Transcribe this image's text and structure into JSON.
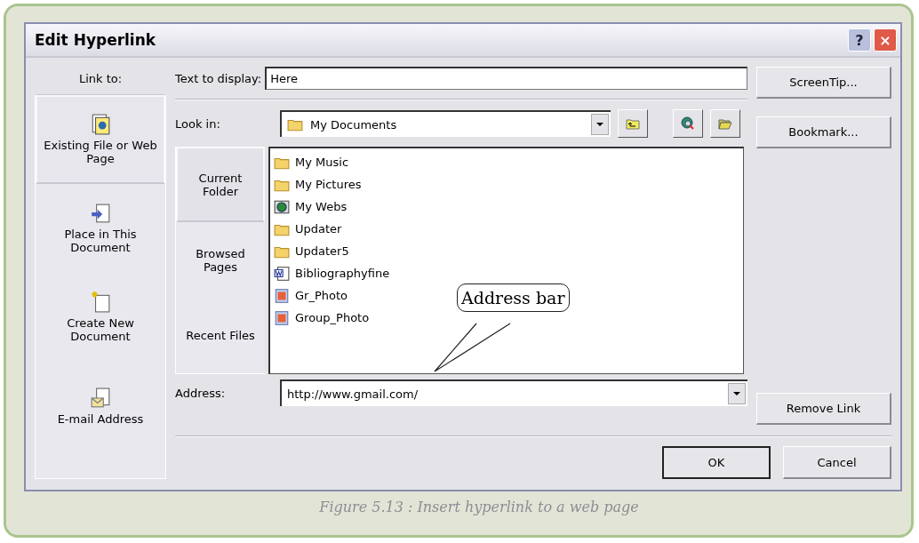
{
  "window": {
    "title": "Edit Hyperlink",
    "title_buttons": [
      "?",
      "×"
    ]
  },
  "link_to": {
    "label": "Link to:",
    "items": [
      {
        "label": "Existing File or Web Page",
        "kind": "file",
        "selected": true
      },
      {
        "label": "Place in This Document",
        "kind": "place",
        "selected": false
      },
      {
        "label": "Create New Document",
        "kind": "new",
        "selected": false
      },
      {
        "label": "E-mail Address",
        "kind": "email",
        "selected": false
      }
    ]
  },
  "text_to_display": {
    "label": "Text to display:",
    "value": "Here"
  },
  "look_in": {
    "label": "Look in:",
    "value": "My Documents"
  },
  "nav": [
    {
      "label": "Current Folder",
      "selected": true
    },
    {
      "label": "Browsed Pages",
      "selected": false
    },
    {
      "label": "Recent Files",
      "selected": false
    }
  ],
  "files": [
    {
      "name": "My Music",
      "kind": "folder"
    },
    {
      "name": "My Pictures",
      "kind": "folder"
    },
    {
      "name": "My Webs",
      "kind": "web"
    },
    {
      "name": "Updater",
      "kind": "folder"
    },
    {
      "name": "Updater5",
      "kind": "folder"
    },
    {
      "name": "Bibliographyfine",
      "kind": "word"
    },
    {
      "name": "Gr_Photo",
      "kind": "photo"
    },
    {
      "name": "Group_Photo",
      "kind": "photo"
    }
  ],
  "address": {
    "label": "Address:",
    "value": "http://www.gmail.com/"
  },
  "callout": "Address bar",
  "side_buttons": [
    "ScreenTip...",
    "Bookmark...",
    "Remove Link"
  ],
  "footer_buttons": [
    {
      "label": "OK",
      "default": true
    },
    {
      "label": "Cancel",
      "default": false
    }
  ],
  "caption": "Figure 5.13 : Insert hyperlink to a web page"
}
